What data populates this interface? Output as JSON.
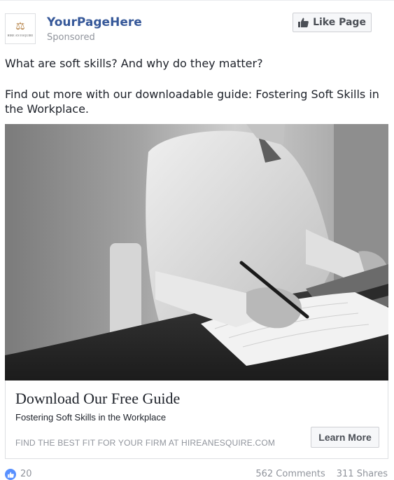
{
  "header": {
    "page_name": "YourPageHere",
    "sponsored": "Sponsored",
    "avatar_text": "HIRE AN ESQUIRE",
    "like_page_label": "Like Page"
  },
  "post": {
    "text_line1": "What are soft skills? And why do they matter?",
    "text_line2": "Find out more with our downloadable guide: Fostering Soft Skills in the Workplace."
  },
  "card": {
    "title": "Download Our Free Guide",
    "subtitle": "Fostering Soft Skills in the Workplace",
    "domain": "FIND THE BEST FIT FOR YOUR FIRM AT HIREANESQUIRE.COM",
    "cta_label": "Learn More"
  },
  "footer": {
    "reaction_count": "20",
    "comments": "562 Comments",
    "shares": "311 Shares"
  },
  "colors": {
    "link_blue": "#365899",
    "meta_gray": "#90949c",
    "like_blue": "#5890ff"
  },
  "icons": [
    "thumbs-up-icon",
    "scales-logo-icon",
    "like-reaction-icon"
  ]
}
